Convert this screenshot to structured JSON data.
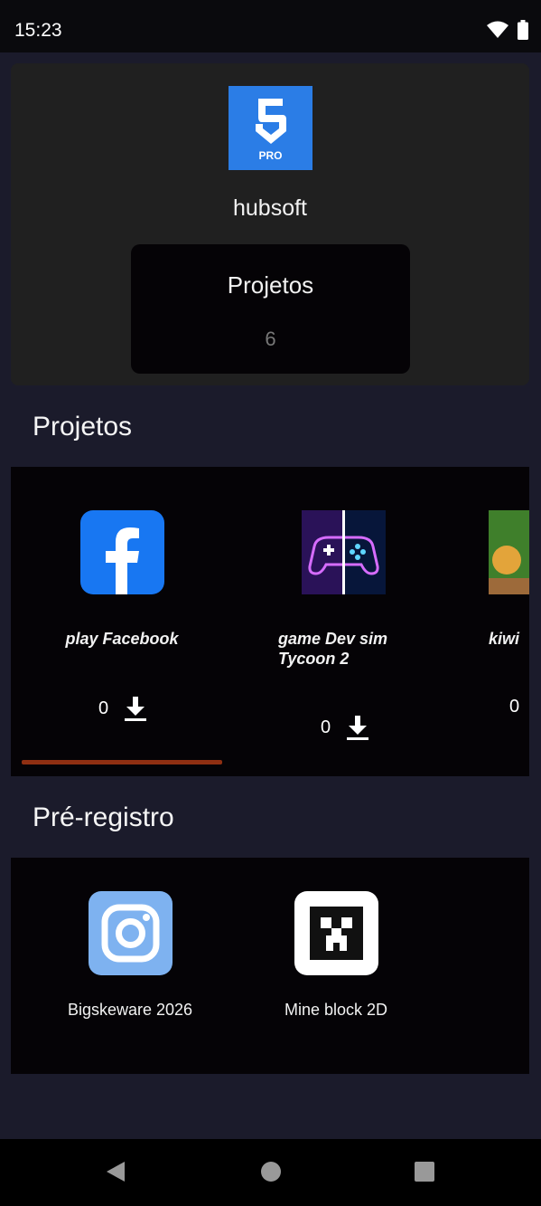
{
  "status_bar": {
    "time": "15:23",
    "icons": [
      "wifi-icon",
      "battery-icon"
    ]
  },
  "profile": {
    "logo_text": "PRO",
    "name": "hubsoft",
    "stat_label": "Projetos",
    "stat_value": "6"
  },
  "projects_section": {
    "title": "Projetos",
    "items": [
      {
        "title": "play Facebook",
        "count": "0",
        "icon": "facebook-icon"
      },
      {
        "title": "game Dev sim Tycoon 2",
        "count": "0",
        "icon": "gamepad-icon"
      },
      {
        "title": "kiwi",
        "count": "0",
        "icon": "game-thumbnail-icon"
      }
    ],
    "accent_color": "#8f2f12"
  },
  "prereg_section": {
    "title": "Pré-registro",
    "items": [
      {
        "title": "Bigskeware 2026",
        "icon": "instagram-icon"
      },
      {
        "title": "Mine block 2D",
        "icon": "creeper-icon"
      }
    ]
  },
  "nav_bar": {
    "buttons": [
      "back-icon",
      "home-icon",
      "recents-icon"
    ]
  }
}
